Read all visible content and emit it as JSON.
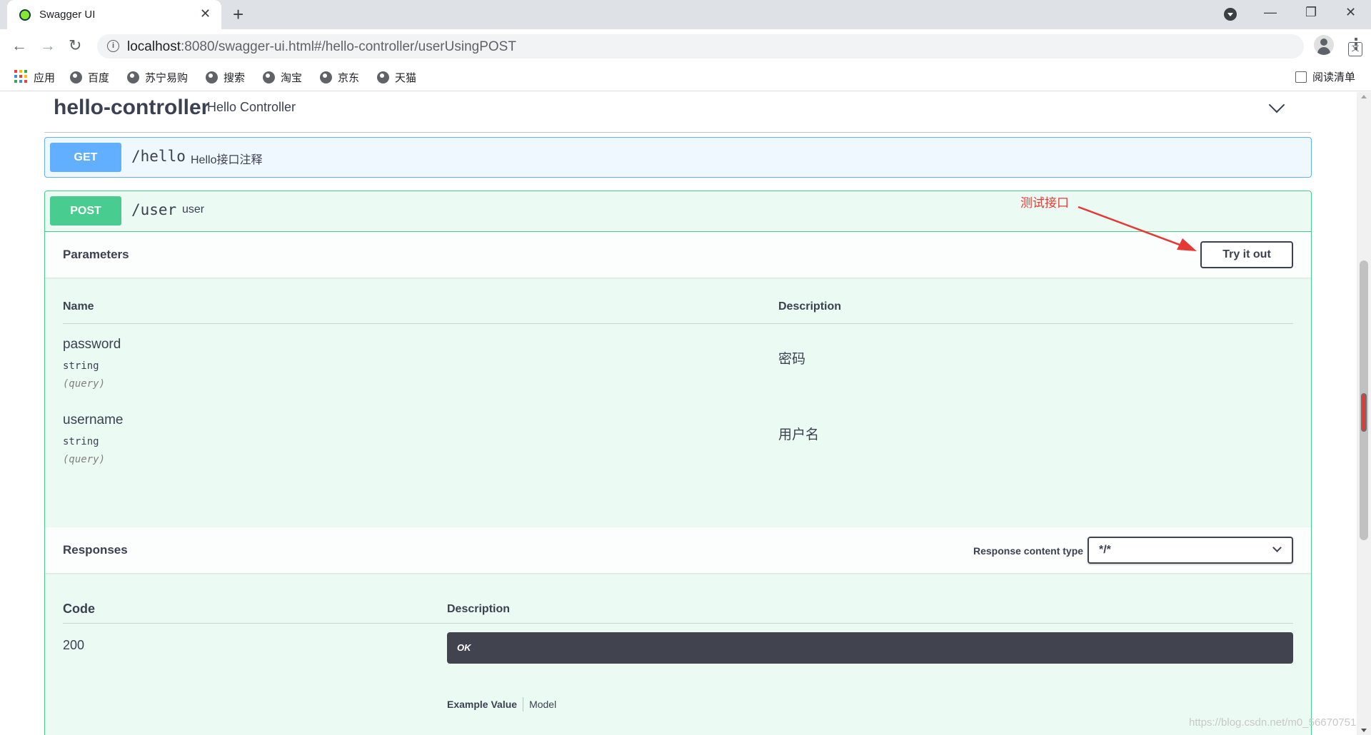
{
  "browser": {
    "tab_title": "Swagger UI",
    "url_host": "localhost",
    "url_rest": ":8080/swagger-ui.html#/hello-controller/userUsingPOST",
    "bookmarks": [
      "应用",
      "百度",
      "苏宁易购",
      "搜索",
      "淘宝",
      "京东",
      "天猫"
    ],
    "reading_list": "阅读清单"
  },
  "section": {
    "title": "hello-controller",
    "description": "Hello Controller"
  },
  "operations": {
    "get": {
      "method": "GET",
      "path": "/hello",
      "summary": "Hello接口注释"
    },
    "post": {
      "method": "POST",
      "path": "/user",
      "summary": "user"
    }
  },
  "parameters": {
    "title": "Parameters",
    "try_button": "Try it out",
    "col_name": "Name",
    "col_description": "Description",
    "rows": [
      {
        "name": "password",
        "type": "string",
        "in": "(query)",
        "description": "密码"
      },
      {
        "name": "username",
        "type": "string",
        "in": "(query)",
        "description": "用户名"
      }
    ]
  },
  "responses": {
    "title": "Responses",
    "content_type_label": "Response content type",
    "content_type_value": "*/*",
    "col_code": "Code",
    "col_description": "Description",
    "code": "200",
    "description": "OK",
    "example_value_tab": "Example Value",
    "model_tab": "Model"
  },
  "annotation": "测试接口",
  "watermark": "https://blog.csdn.net/m0_56670751",
  "colors": {
    "get": "#61affe",
    "post": "#49cc90",
    "annotation": "#e53935"
  }
}
